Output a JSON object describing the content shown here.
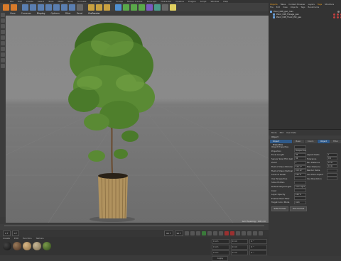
{
  "menubar": {
    "items": [
      "File",
      "Edit",
      "Create",
      "Select",
      "Tools",
      "Mesh",
      "Snap",
      "Animate",
      "Simulate",
      "Render",
      "Sculpt",
      "Motion Tracker",
      "MoGraph",
      "Character",
      "Pipeline",
      "Plugins",
      "Script",
      "Window",
      "Help"
    ]
  },
  "viewport": {
    "menu": [
      "View",
      "Cameras",
      "Display",
      "Options",
      "Filter",
      "Panel",
      "ProRender"
    ],
    "status": "Grid Spacing : 100 cm"
  },
  "timeline": {
    "start_field": "0 F",
    "current_field": "0 F",
    "end_field": "90 F",
    "end2_field": "90 F",
    "frame_label": "0 F"
  },
  "material_manager": {
    "menu": [
      "Create",
      "Edit",
      "Function",
      "Texture"
    ],
    "swatch_colors": [
      "#111111",
      "#6b4a2a",
      "#b08858",
      "#9a8a6a",
      "#4f6a2a",
      "#7a7a7a"
    ]
  },
  "coordinates": {
    "rows": [
      [
        "0 cm",
        "0 cm",
        "0 °"
      ],
      [
        "0 cm",
        "0 cm",
        "0 °"
      ],
      [
        "0 cm",
        "0 cm",
        "0 °"
      ]
    ],
    "apply_label": "Apply"
  },
  "object_manager": {
    "tabs": [
      "Objects",
      "Takes",
      "Content Browser",
      "Layers",
      "Tags",
      "Structure"
    ],
    "active_tab": "Objects",
    "menu": [
      "File",
      "Edit",
      "View",
      "Objects",
      "Tags",
      "Bookmarks"
    ],
    "objects": [
      {
        "name": "Plant_048_geo_max"
      },
      {
        "name": "Plant_048_Foliage_geo"
      },
      {
        "name": "Plant_048_Trunk_Pot_geo"
      }
    ]
  },
  "attribute_manager": {
    "menu": [
      "Mode",
      "Edit",
      "User Data"
    ],
    "header": "Object",
    "tabs": [
      "Object Properties",
      "Basic",
      "Coord.",
      "Object",
      "Filter"
    ],
    "rows_left": [
      {
        "label": "Object Properties",
        "value": ""
      },
      {
        "label": "Projection",
        "value": "Perspective"
      },
      {
        "label": "Focal Length",
        "value": "36"
      },
      {
        "label": "Sensor Size (Film Gate)",
        "value": "36"
      },
      {
        "label": "Zoom",
        "value": "1"
      },
      {
        "label": "Field of View (Horizontal)",
        "value": "53.13 °"
      },
      {
        "label": "Field of View (Vertical)",
        "value": "41.112 °"
      },
      {
        "label": "Level of Detail",
        "value": "100 %"
      },
      {
        "label": "Use Perspective",
        "value": ""
      },
      {
        "label": "Show Hidden",
        "value": ""
      },
      {
        "label": "Default Object Light",
        "value": "Auto Light"
      },
      {
        "label": "Color",
        "value": ""
      },
      {
        "label": "Layer Opacity",
        "value": "100 %"
      },
      {
        "label": "Enable Mesh Filter",
        "value": ""
      },
      {
        "label": "Target Color Mode",
        "value": "Auto"
      }
    ],
    "rows_right": [
      {
        "label": "Aspect Ratio",
        "value": "1"
      },
      {
        "label": "Tolerance",
        "value": "0.5"
      },
      {
        "label": "Min Distance",
        "value": "0 cm"
      },
      {
        "label": "Max Distance",
        "value": "0 cm"
      },
      {
        "label": "Render Delta",
        "value": ""
      },
      {
        "label": "Use Pixel Aspect",
        "value": ""
      },
      {
        "label": "Use Resolution",
        "value": ""
      }
    ],
    "buttons": [
      "Safe Frames",
      "Film Format"
    ]
  },
  "chart_colors": {
    "foliage_dark": "#3d6a22",
    "foliage_mid": "#5a8a34",
    "foliage_light": "#7aa848",
    "pot": "#b0925e",
    "pot_dark": "#7a6038"
  }
}
